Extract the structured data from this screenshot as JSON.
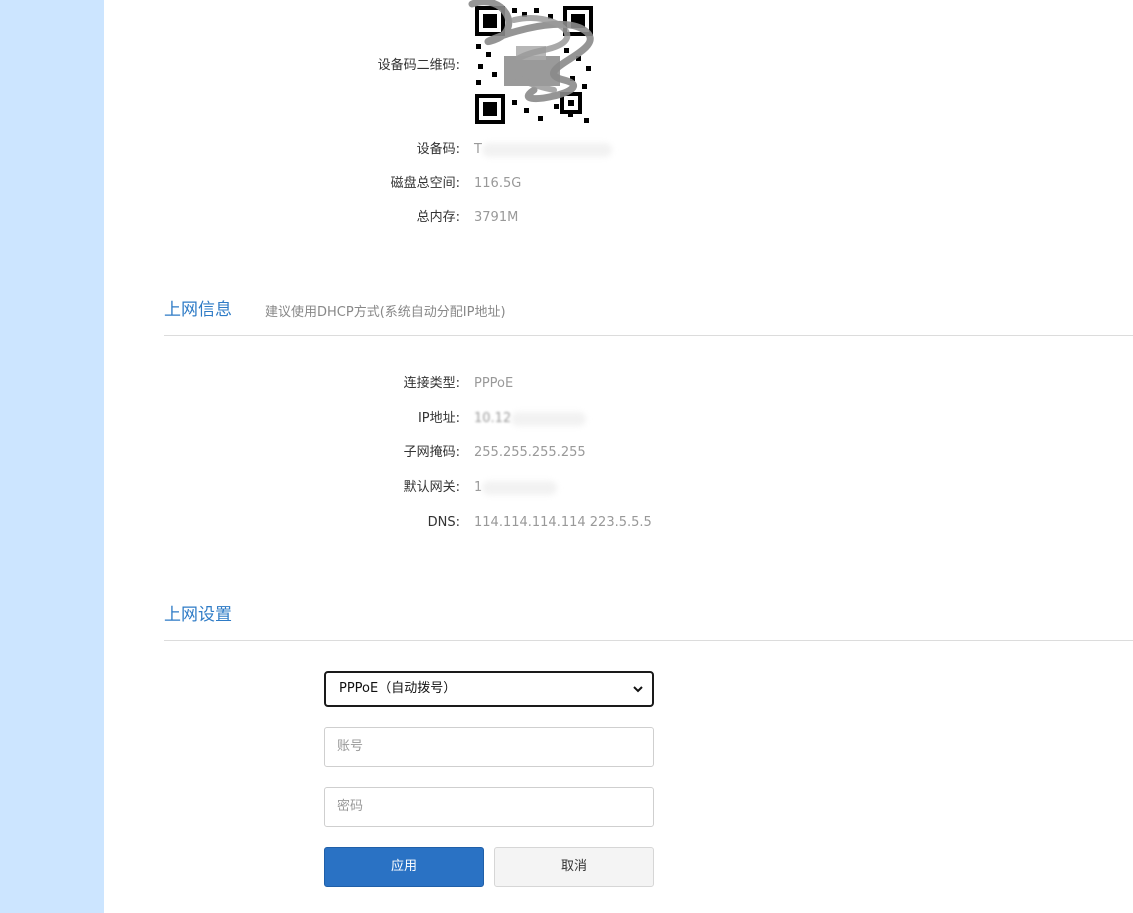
{
  "device": {
    "qr_label": "设备码二维码:",
    "code_label": "设备码:",
    "code_value": "T",
    "disk_label": "磁盘总空间:",
    "disk_value": "116.5G",
    "memory_label": "总内存:",
    "memory_value": "3791M"
  },
  "network_info": {
    "title": "上网信息",
    "subtitle": "建议使用DHCP方式(系统自动分配IP地址)",
    "conn_type_label": "连接类型:",
    "conn_type_value": "PPPoE",
    "ip_label": "IP地址:",
    "ip_value": "10.12",
    "mask_label": "子网掩码:",
    "mask_value": "255.255.255.255",
    "gateway_label": "默认网关:",
    "gateway_value": "1",
    "dns_label": "DNS:",
    "dns_value": "114.114.114.114 223.5.5.5"
  },
  "network_settings": {
    "title": "上网设置",
    "mode_select": "PPPoE（自动拨号）",
    "account_placeholder": "账号",
    "password_placeholder": "密码",
    "apply_label": "应用",
    "cancel_label": "取消"
  },
  "colors": {
    "sidebar": "#cce5ff",
    "accent": "#2e7bc6",
    "primary_button": "#2a72c4"
  }
}
